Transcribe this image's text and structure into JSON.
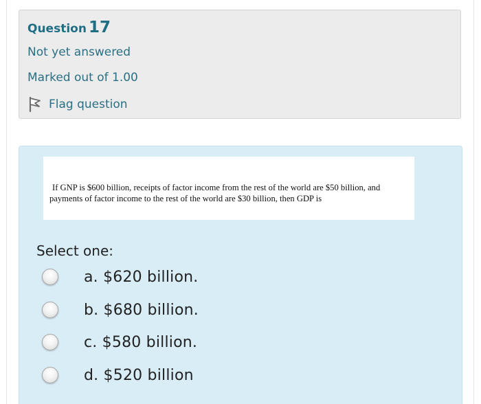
{
  "question": {
    "label": "Question",
    "number": "17",
    "state": "Not yet answered",
    "grade": "Marked out of 1.00",
    "flag_label": "Flag question"
  },
  "content": {
    "question_text": "If GNP is $600 billion, receipts of factor income from the rest of the world are $50 billion, and payments of factor income to the rest of the world are $30 billion, then GDP is",
    "prompt": "Select one:",
    "options": [
      {
        "label": "a. $620 billion."
      },
      {
        "label": "b. $680 billion."
      },
      {
        "label": "c. $580 billion."
      },
      {
        "label": "d. $520 billion"
      }
    ]
  },
  "colors": {
    "accent": "#1f6e84",
    "info_background": "#ececec",
    "content_background": "#d9edf7"
  },
  "icons": {
    "flag": "flag-icon"
  }
}
